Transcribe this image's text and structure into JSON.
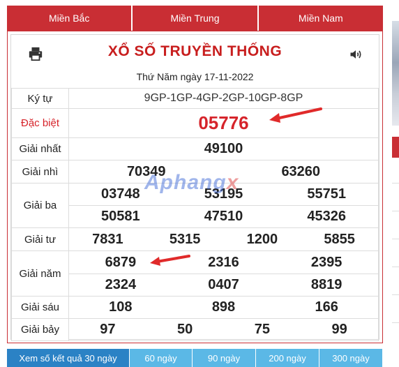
{
  "tabs": [
    "Miền Bắc",
    "Miền Trung",
    "Miền Nam"
  ],
  "header": {
    "title": "XỔ SỐ TRUYỀN THỐNG",
    "date": "Thứ Năm ngày 17-11-2022"
  },
  "results": {
    "ky_tu": {
      "label": "Ký tự",
      "value": "9GP-1GP-4GP-2GP-10GP-8GP"
    },
    "dac_biet": {
      "label": "Đặc biệt",
      "value": "05776"
    },
    "nhat": {
      "label": "Giải nhất",
      "values": [
        "49100"
      ]
    },
    "nhi": {
      "label": "Giải nhì",
      "values": [
        "70349",
        "63260"
      ]
    },
    "ba": {
      "label": "Giải ba",
      "values": [
        "03748",
        "53195",
        "55751",
        "50581",
        "47510",
        "45326"
      ]
    },
    "tu": {
      "label": "Giải tư",
      "values": [
        "7831",
        "5315",
        "1200",
        "5855"
      ]
    },
    "nam": {
      "label": "Giải năm",
      "values": [
        "6879",
        "2316",
        "2395",
        "2324",
        "0407",
        "8819"
      ]
    },
    "sau": {
      "label": "Giải sáu",
      "values": [
        "108",
        "898",
        "166"
      ]
    },
    "bay": {
      "label": "Giải bảy",
      "values": [
        "97",
        "50",
        "75",
        "99"
      ]
    }
  },
  "watermark": {
    "main": "Aphang",
    "accent": "x"
  },
  "footer_tabs": [
    "Xem số kết quả 30 ngày",
    "60 ngày",
    "90 ngày",
    "200 ngày",
    "300 ngày"
  ],
  "colors": {
    "brand_red": "#c92e34",
    "prize_red": "#d6242b",
    "footer_active": "#2b82c5",
    "footer_tab": "#5bb8e6"
  },
  "icons": {
    "print": "printer-icon",
    "sound": "speaker-icon"
  }
}
